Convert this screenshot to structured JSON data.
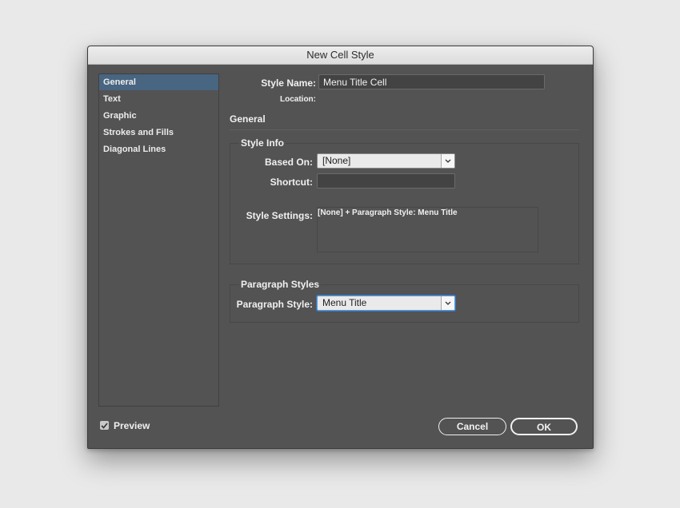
{
  "window": {
    "title": "New Cell Style"
  },
  "sidebar": {
    "items": [
      {
        "label": "General",
        "selected": true
      },
      {
        "label": "Text",
        "selected": false
      },
      {
        "label": "Graphic",
        "selected": false
      },
      {
        "label": "Strokes and Fills",
        "selected": false
      },
      {
        "label": "Diagonal Lines",
        "selected": false
      }
    ]
  },
  "form": {
    "style_name_label": "Style Name:",
    "style_name_value": "Menu Title Cell",
    "location_label": "Location:",
    "section_title": "General"
  },
  "style_info": {
    "group_title": "Style Info",
    "based_on_label": "Based On:",
    "based_on_value": "[None]",
    "shortcut_label": "Shortcut:",
    "shortcut_value": "",
    "style_settings_label": "Style Settings:",
    "style_settings_value": "[None] + Paragraph Style: Menu Title"
  },
  "paragraph_styles": {
    "group_title": "Paragraph Styles",
    "paragraph_style_label": "Paragraph Style:",
    "paragraph_style_value": "Menu Title"
  },
  "footer": {
    "preview_label": "Preview",
    "preview_checked": true,
    "cancel_label": "Cancel",
    "ok_label": "OK"
  },
  "colors": {
    "dialog_bg": "#535353",
    "selection": "#486581",
    "focus_ring": "#3a78c0"
  }
}
